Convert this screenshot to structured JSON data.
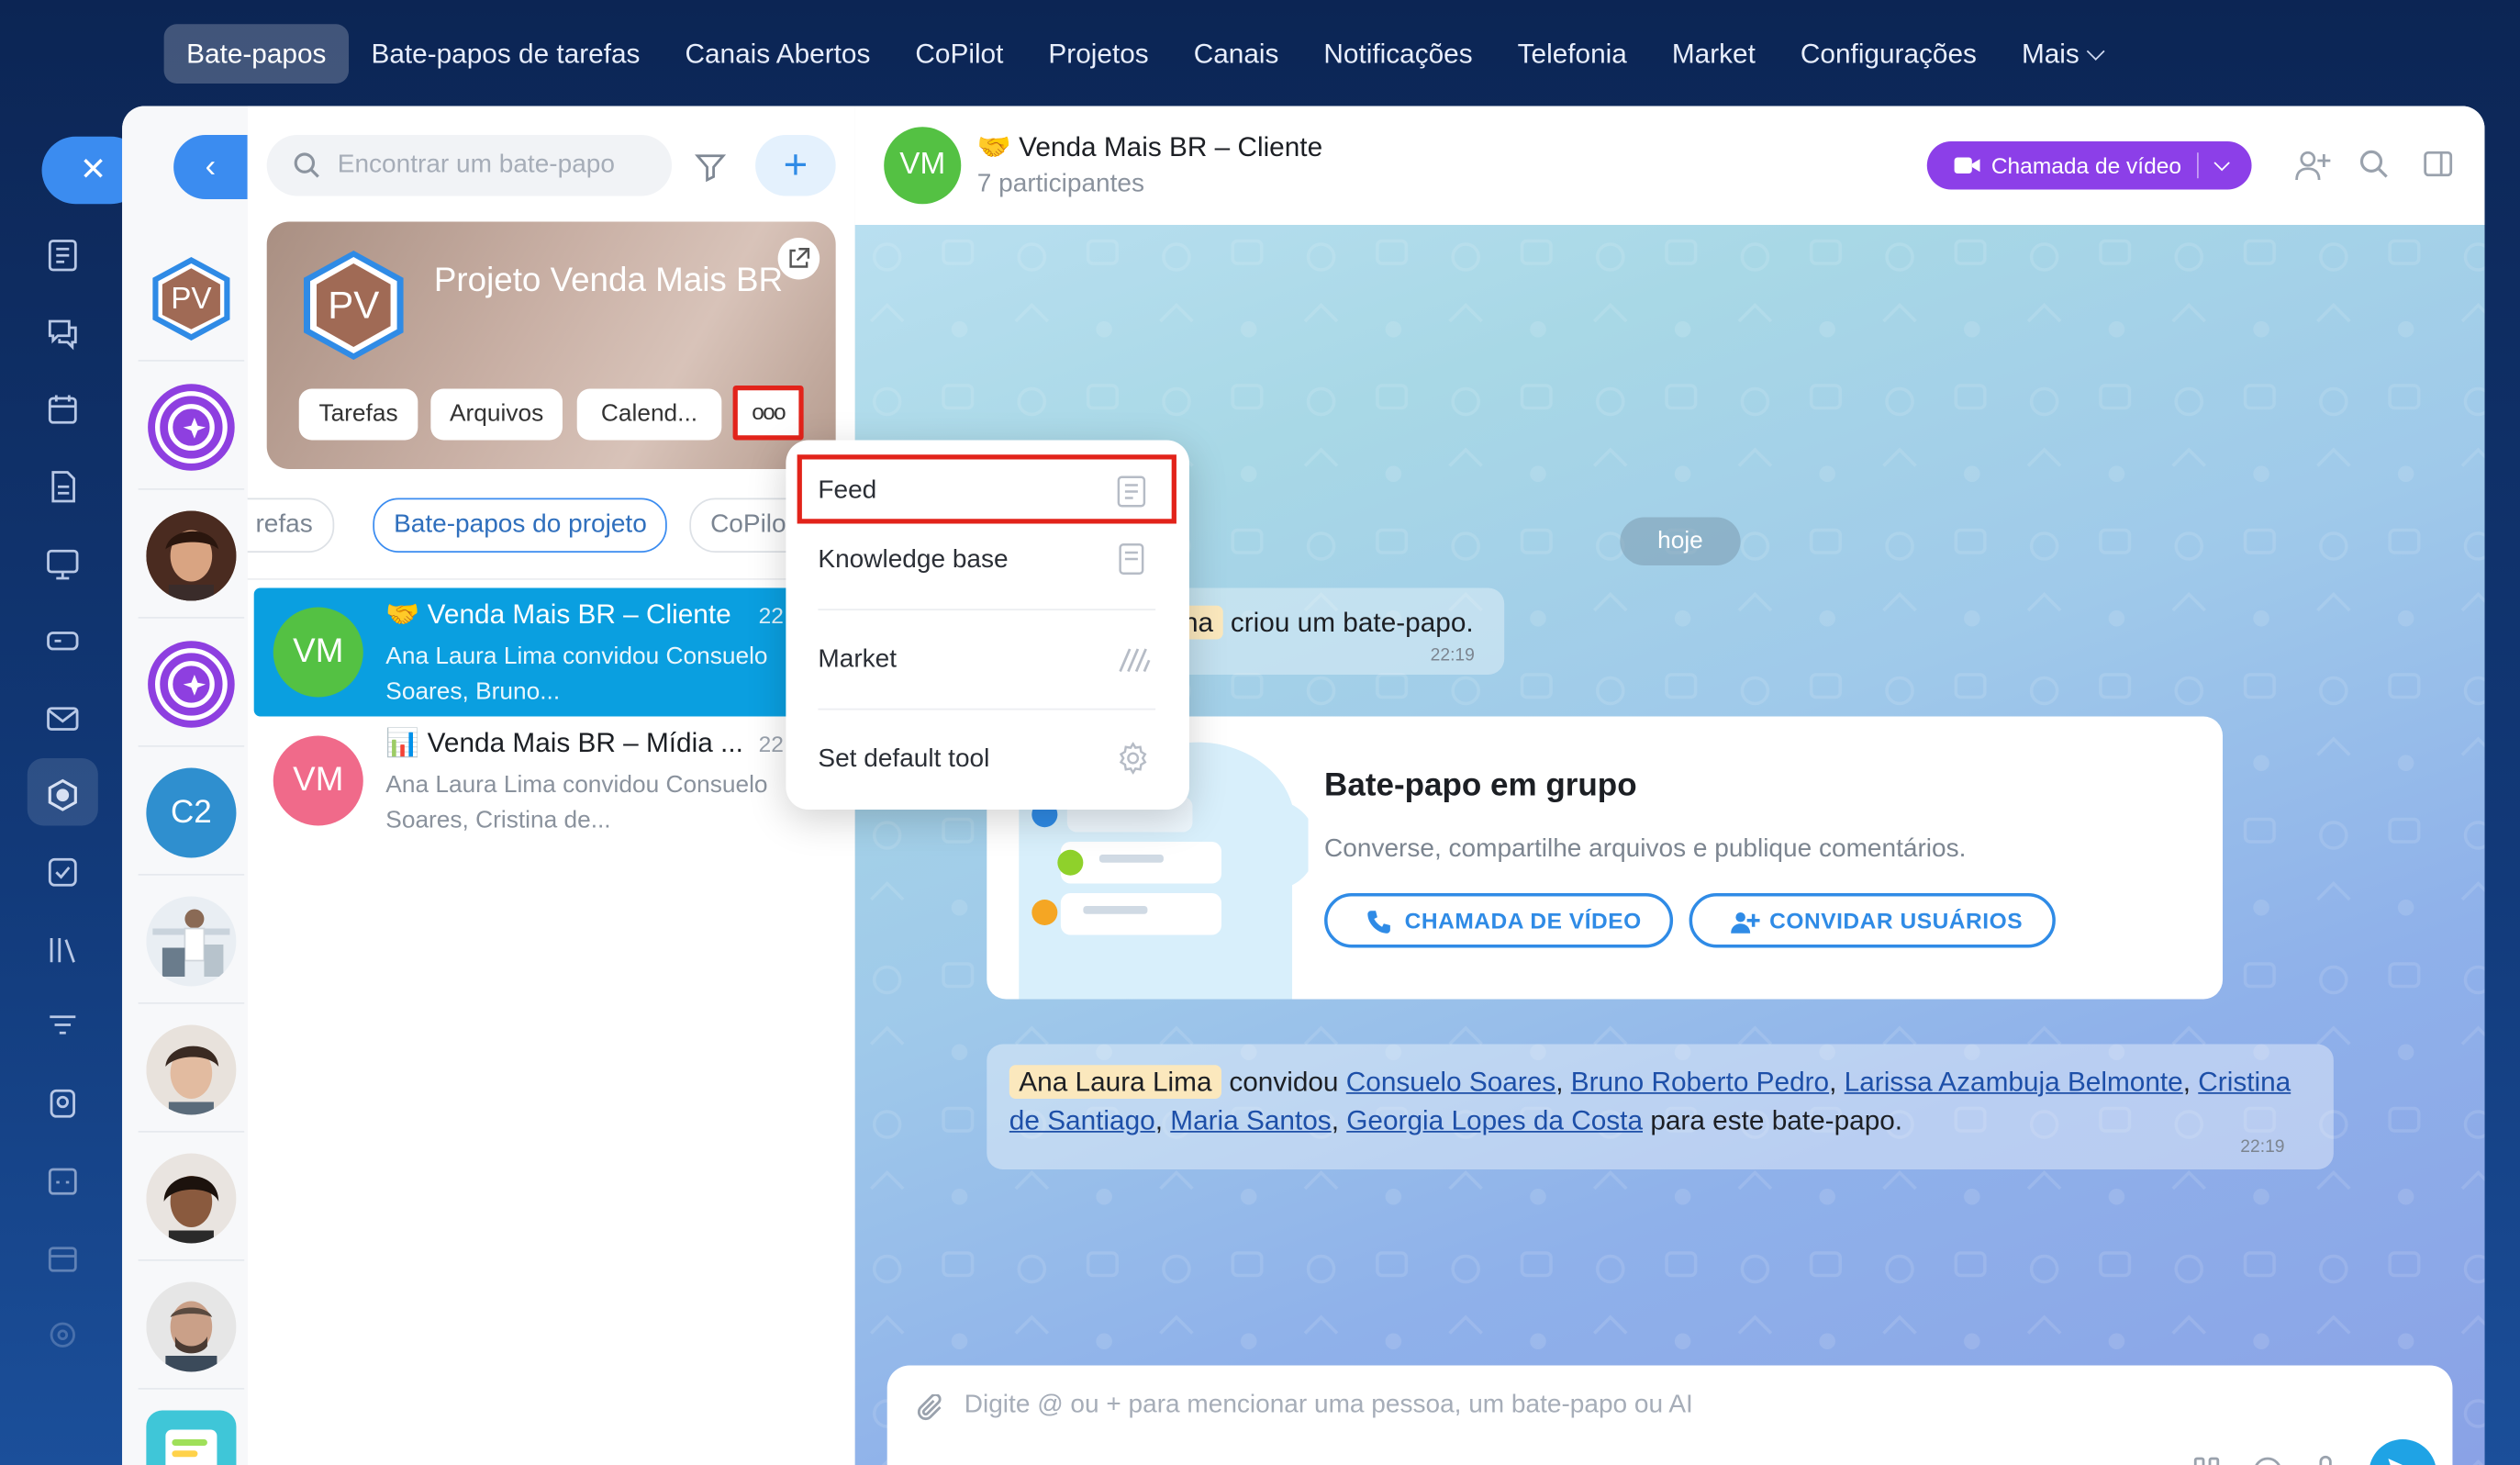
{
  "topnav": [
    {
      "label": "Bate-papos",
      "active": true
    },
    {
      "label": "Bate-papos de tarefas"
    },
    {
      "label": "Canais Abertos"
    },
    {
      "label": "CoPilot"
    },
    {
      "label": "Projetos"
    },
    {
      "label": "Canais"
    },
    {
      "label": "Notificações"
    },
    {
      "label": "Telefonia"
    },
    {
      "label": "Market"
    },
    {
      "label": "Configurações"
    },
    {
      "label": "Mais"
    }
  ],
  "recents": [
    {
      "initials": "PV"
    },
    {
      "initials": ""
    },
    {
      "initials": ""
    },
    {
      "initials": ""
    },
    {
      "initials": "C2"
    }
  ],
  "search": {
    "placeholder": "Encontrar um bate-papo"
  },
  "project": {
    "initials": "PV",
    "title": "Projeto Venda Mais BR",
    "buttons": [
      "Tarefas",
      "Arquivos",
      "Calend...",
      "ooo"
    ]
  },
  "tabs": [
    "refas",
    "Bate-papos do projeto",
    "CoPilo"
  ],
  "chats": [
    {
      "name": "Venda Mais BR – Cliente",
      "time": "22",
      "initials": "VM",
      "preview": "Ana Laura Lima convidou Consuelo Soares, Bruno...",
      "emoji": "🤝"
    },
    {
      "name": "Venda Mais BR – Mídia ...",
      "time": "22",
      "initials": "VM",
      "preview": "Ana Laura Lima convidou Consuelo Soares, Cristina de...",
      "emoji": "📊"
    }
  ],
  "menu": {
    "items": [
      "Feed",
      "Knowledge base",
      "Market",
      "Set default tool"
    ]
  },
  "chat": {
    "initials": "VM",
    "title": "Venda Mais BR – Cliente",
    "title_emoji": "🤝",
    "subtitle": "7 participantes",
    "video_button": "Chamada de vídeo",
    "day": "hoje",
    "sys_name": "na",
    "sys_text": "criou um bate-papo.",
    "sys_time": "22:19",
    "card_title": "Bate-papo em grupo",
    "card_sub": "Converse, compartilhe arquivos e publique comentários.",
    "card_btn_video": "CHAMADA DE VÍDEO",
    "card_btn_invite": "CONVIDAR USUÁRIOS",
    "invite_author": "Ana Laura Lima",
    "invite_verb": "convidou",
    "invitees": [
      "Consuelo Soares",
      "Bruno Roberto Pedro",
      "Larissa Azambuja Belmonte",
      "Cristina de Santiago",
      "Maria Santos",
      "Georgia Lopes da Costa"
    ],
    "invite_tail": "para este bate-papo.",
    "invite_time": "22:19",
    "composer_placeholder": "Digite @ ou + para mencionar uma pessoa, um bate-papo ou AI"
  },
  "colors": {
    "accent": "#3b8cf0",
    "active_chat": "#0a9fe0",
    "video": "#8c3fe8",
    "highlight": "#e2231a"
  }
}
